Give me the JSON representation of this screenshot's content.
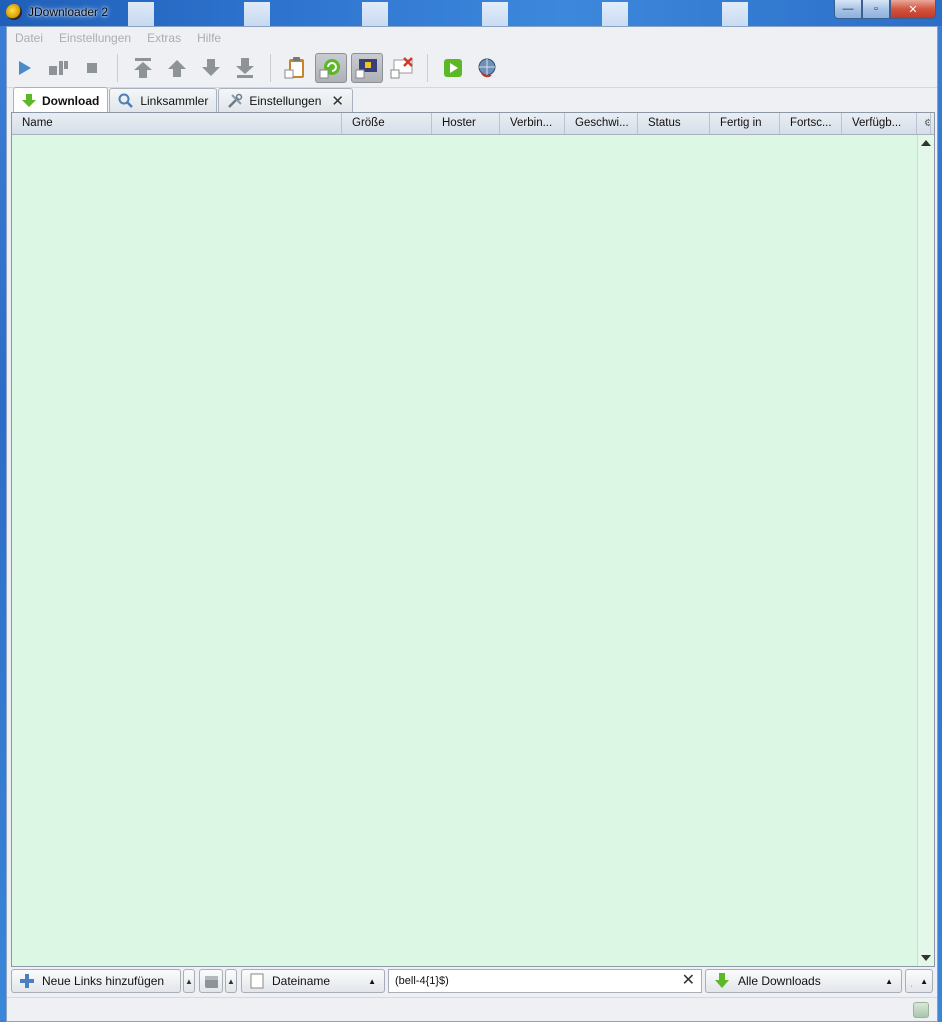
{
  "window": {
    "title": "JDownloader 2",
    "controls": {
      "minimize": "—",
      "maximize": "▫",
      "close": "✕"
    }
  },
  "menu": [
    "Datei",
    "Einstellungen",
    "Extras",
    "Hilfe"
  ],
  "toolbar": {
    "buttons": [
      "play-icon",
      "pause-icon",
      "stop-icon",
      "move-top-icon",
      "move-up-icon",
      "move-down-icon",
      "move-bottom-icon",
      "clipboard-observer-icon",
      "auto-reconnect-icon",
      "premium-icon",
      "silent-mode-icon",
      "update-icon",
      "reconnect-icon"
    ]
  },
  "tabs": [
    {
      "label": "Download",
      "icon": "download-arrow-icon",
      "active": true
    },
    {
      "label": "Linksammler",
      "icon": "linkgrabber-icon",
      "active": false
    },
    {
      "label": "Einstellungen",
      "icon": "tools-icon",
      "active": false,
      "closable": true,
      "close": "✕"
    }
  ],
  "table": {
    "columns": [
      "Name",
      "Größe",
      "Hoster",
      "Verbin...",
      "Geschwi...",
      "Status",
      "Fertig in",
      "Fortsc...",
      "Verfügb..."
    ],
    "rows": []
  },
  "bottom": {
    "add_links_label": "Neue Links hinzufügen",
    "filter_field_label": "Dateiname",
    "search_value": "(bell-4{1}$)",
    "clear_symbol": "✕",
    "view_label": "Alle Downloads",
    "arrow_symbol": "▲"
  },
  "colors": {
    "accent_green": "#5db828",
    "table_background": "#dcf8e4",
    "menu_disabled_text": "#a9aeb4"
  }
}
